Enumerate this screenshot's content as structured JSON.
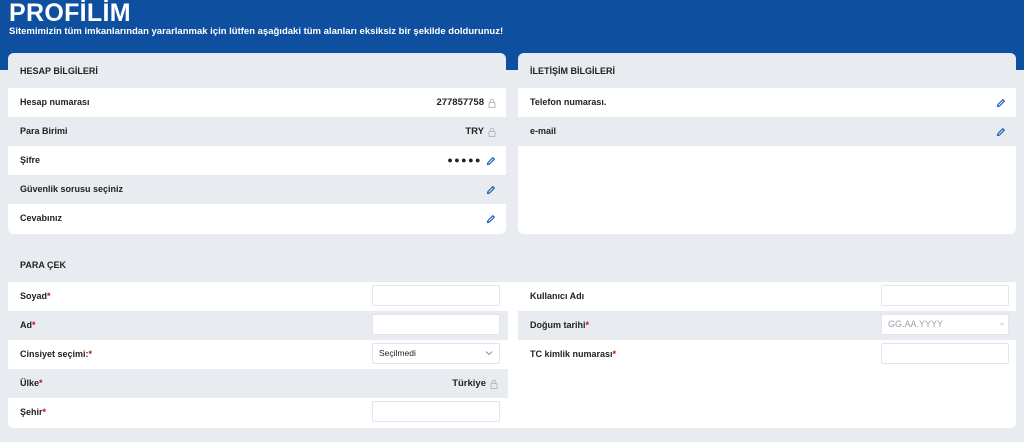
{
  "header": {
    "title": "PROFİLİM",
    "subtitle": "Sitemimizin tüm imkanlarından yararlanmak için lütfen aşağıdaki tüm alanları eksiksiz bir şekilde doldurunuz!"
  },
  "account": {
    "title": "HESAP BİLGİLERİ",
    "account_number_label": "Hesap numarası",
    "account_number_value": "277857758",
    "currency_label": "Para Birimi",
    "currency_value": "TRY",
    "password_label": "Şifre",
    "password_value": "●●●●●",
    "security_question_label": "Güvenlik sorusu seçiniz",
    "answer_label": "Cevabınız"
  },
  "contact": {
    "title": "İLETİŞİM BİLGİLERİ",
    "phone_label": "Telefon numarası.",
    "email_label": "e-mail"
  },
  "withdraw": {
    "title": "PARA ÇEK",
    "surname_label": "Soyad",
    "name_label": "Ad",
    "gender_label": "Cinsiyet seçimi:",
    "gender_value": "Seçilmedi",
    "country_label": "Ülke",
    "country_value": "Türkiye",
    "city_label": "Şehir",
    "username_label": "Kullanıcı Adı",
    "birthdate_label": "Doğum tarihi",
    "birthdate_placeholder": "GG.AA.YYYY",
    "tc_label": "TC kimlik numarası",
    "required_mark": "*"
  },
  "colors": {
    "brand_blue": "#0f4fa0",
    "required_red": "#d0021b",
    "row_alt": "#e8ebf0"
  },
  "icons": [
    "lock-icon",
    "pencil-icon",
    "chevron-down-icon"
  ]
}
